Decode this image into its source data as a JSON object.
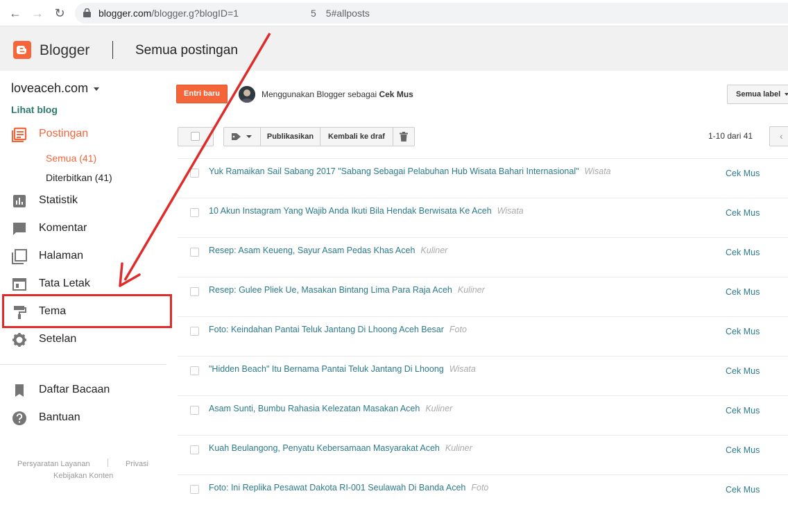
{
  "browser": {
    "url_host": "blogger.com",
    "url_path_start": "/blogger.g?blogID=1",
    "url_path_mid": "5",
    "url_path_end": "5#allposts"
  },
  "header": {
    "brand": "Blogger",
    "page_title": "Semua postingan"
  },
  "sidebar": {
    "blog_name": "loveaceh.com",
    "view_blog": "Lihat blog",
    "items": [
      {
        "label": "Postingan",
        "icon": "posts-icon",
        "active": true
      },
      {
        "label": "Statistik",
        "icon": "stats-icon"
      },
      {
        "label": "Komentar",
        "icon": "comment-icon"
      },
      {
        "label": "Halaman",
        "icon": "pages-icon"
      },
      {
        "label": "Tata Letak",
        "icon": "layout-icon"
      },
      {
        "label": "Tema",
        "icon": "paint-roller-icon"
      },
      {
        "label": "Setelan",
        "icon": "gear-icon"
      },
      {
        "label": "Daftar Bacaan",
        "icon": "bookmark-icon"
      },
      {
        "label": "Bantuan",
        "icon": "help-icon"
      }
    ],
    "sub_items": [
      {
        "label": "Semua (41)",
        "active": true
      },
      {
        "label": "Diterbitkan (41)"
      }
    ],
    "footer": {
      "terms": "Persyaratan Layanan",
      "privacy": "Privasi",
      "content_policy": "Kebijakan Konten"
    }
  },
  "main": {
    "new_post": "Entri baru",
    "using_prefix": "Menggunakan Blogger sebagai",
    "using_user": "Cek Mus",
    "label_filter": "Semua label",
    "toolbar": {
      "publish": "Publikasikan",
      "revert_draft": "Kembali ke draf"
    },
    "pager": "1-10 dari 41",
    "posts": [
      {
        "title": "Yuk Ramaikan Sail Sabang 2017 \"Sabang Sebagai Pelabuhan Hub Wisata Bahari Internasional\"",
        "category": "Wisata",
        "author": "Cek Mus"
      },
      {
        "title": "10 Akun Instagram Yang Wajib Anda Ikuti Bila Hendak Berwisata Ke Aceh",
        "category": "Wisata",
        "author": "Cek Mus"
      },
      {
        "title": "Resep: Asam Keueng, Sayur Asam Pedas Khas Aceh",
        "category": "Kuliner",
        "author": "Cek Mus"
      },
      {
        "title": "Resep: Gulee Pliek Ue, Masakan Bintang Lima Para Raja Aceh",
        "category": "Kuliner",
        "author": "Cek Mus"
      },
      {
        "title": "Foto: Keindahan Pantai Teluk Jantang Di Lhoong Aceh Besar",
        "category": "Foto",
        "author": "Cek Mus"
      },
      {
        "title": "\"Hidden Beach\" Itu Bernama Pantai Teluk Jantang Di Lhoong",
        "category": "Wisata",
        "author": "Cek Mus"
      },
      {
        "title": "Asam Sunti, Bumbu Rahasia Kelezatan Masakan Aceh",
        "category": "Kuliner",
        "author": "Cek Mus"
      },
      {
        "title": "Kuah Beulangong, Penyatu Kebersamaan Masyarakat Aceh",
        "category": "Kuliner",
        "author": "Cek Mus"
      },
      {
        "title": "Foto: Ini Replika Pesawat Dakota RI-001 Seulawah Di Banda Aceh",
        "category": "Foto",
        "author": "Cek Mus"
      }
    ]
  },
  "colors": {
    "accent": "#f4653a",
    "link": "#2b7a8a",
    "annotation": "#e02b2b"
  }
}
